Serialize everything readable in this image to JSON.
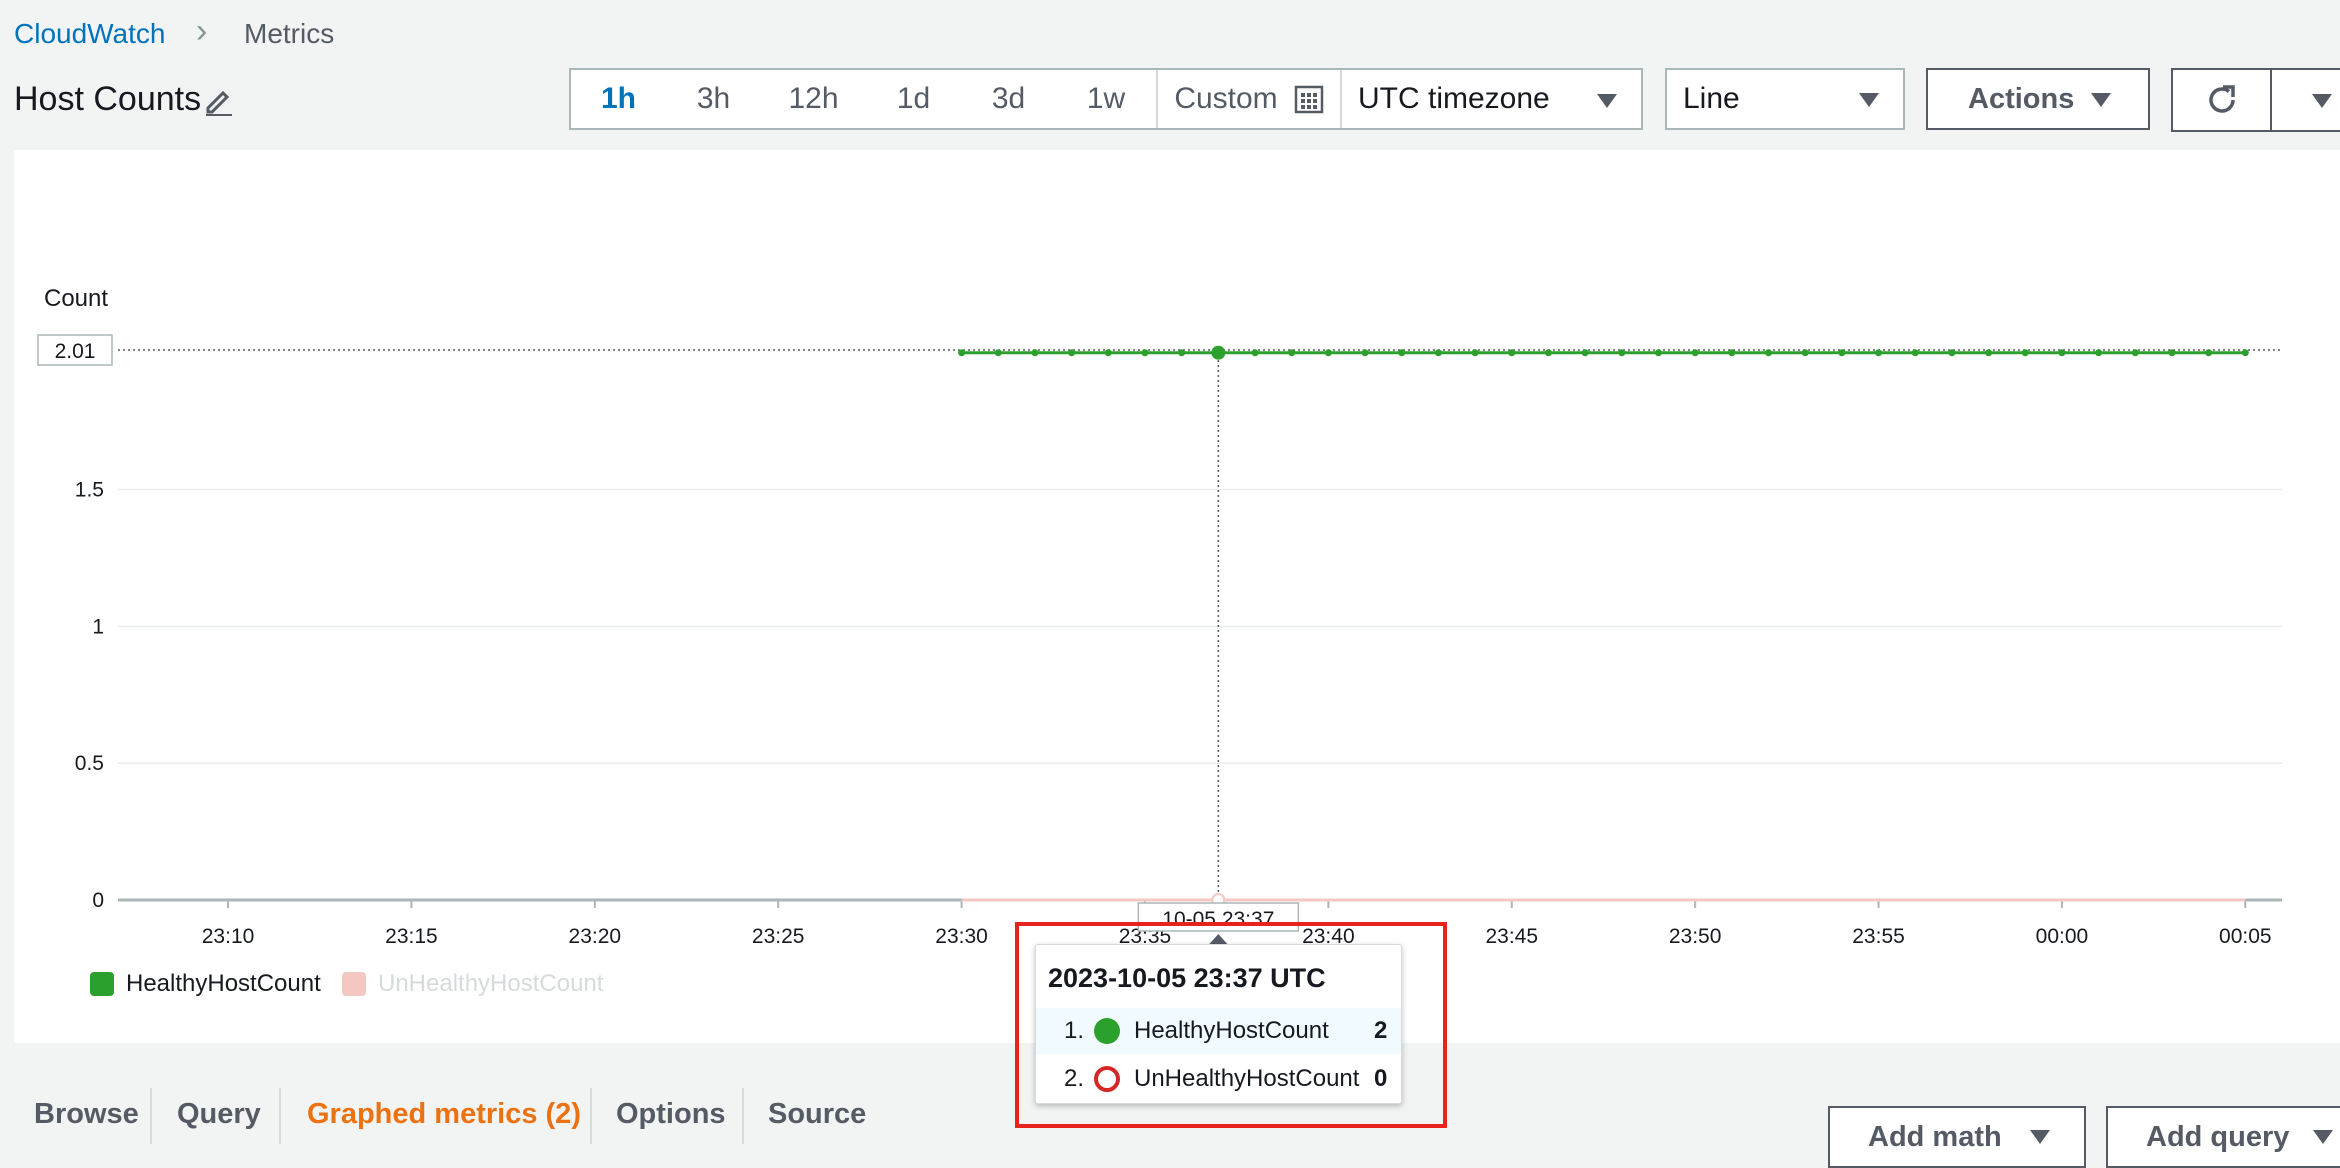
{
  "breadcrumb": {
    "root": "CloudWatch",
    "current": "Metrics"
  },
  "title": "Host Counts",
  "time_ranges": [
    "1h",
    "3h",
    "12h",
    "1d",
    "3d",
    "1w"
  ],
  "custom_label": "Custom",
  "timezone": "UTC timezone",
  "chart_type_select": "Line",
  "actions_label": "Actions",
  "tabs": [
    "Browse",
    "Query",
    "Graphed metrics (2)",
    "Options",
    "Source"
  ],
  "add_math": "Add math",
  "add_query": "Add query",
  "colors": {
    "accent": "#0073bb",
    "active_tab": "#ec7211",
    "healthy": "#2ca02c",
    "unhealthy": "#d62728",
    "highlight": "#e8231c"
  },
  "chart_data": {
    "type": "line",
    "ylabel": "Count",
    "ylim": [
      0,
      2.01
    ],
    "y_ticks": [
      "0",
      "0.5",
      "1",
      "1.5"
    ],
    "threshold_label": "2.01",
    "x_ticks": [
      "23:10",
      "23:15",
      "23:20",
      "23:25",
      "23:30",
      "23:35",
      "23:40",
      "23:45",
      "23:50",
      "23:55",
      "00:00",
      "00:05"
    ],
    "x_range": [
      "23:07",
      "00:06"
    ],
    "crosshair_label": "10-05 23:37",
    "series": [
      {
        "name": "HealthyHostCount",
        "color": "#2ca02c",
        "start": "23:30",
        "end": "00:05",
        "value": 2
      },
      {
        "name": "UnHealthyHostCount",
        "color": "#f4c7c3",
        "start": "23:30",
        "end": "00:05",
        "value": 0
      }
    ]
  },
  "tooltip": {
    "title": "2023-10-05 23:37 UTC",
    "rows": [
      {
        "idx": "1.",
        "name": "HealthyHostCount",
        "value": "2"
      },
      {
        "idx": "2.",
        "name": "UnHealthyHostCount",
        "value": "0"
      }
    ]
  }
}
